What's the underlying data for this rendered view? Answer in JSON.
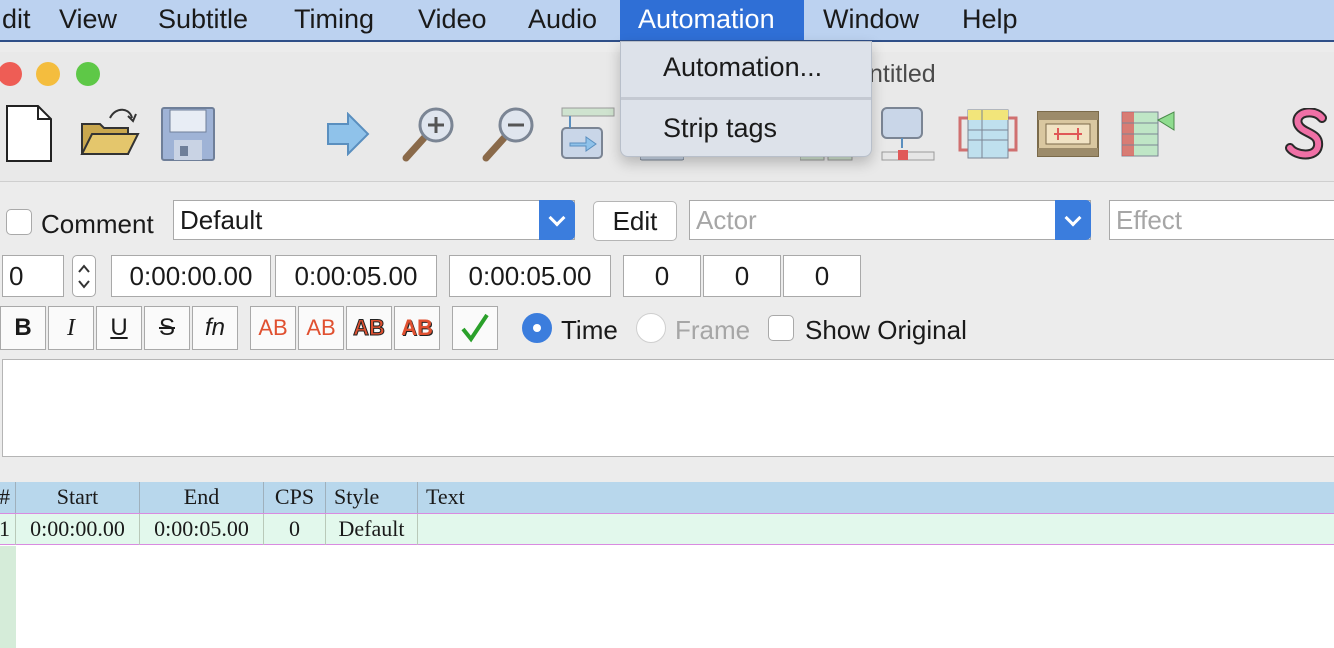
{
  "menubar": {
    "items": [
      "dit",
      "View",
      "Subtitle",
      "Timing",
      "Video",
      "Audio",
      "Automation",
      "Window",
      "Help"
    ],
    "active": "Automation"
  },
  "window": {
    "title": "ntitled"
  },
  "dropdown": {
    "automation": "Automation...",
    "strip_tags": "Strip tags"
  },
  "toolbar": {
    "icons": [
      "new-file-icon",
      "open-folder-icon",
      "save-disk-icon",
      "jump-arrow-icon",
      "zoom-in-icon",
      "zoom-out-icon",
      "snap-icon",
      "video-jump-icon",
      "styles-manager-icon",
      "attachments-icon",
      "karaoke-icon",
      "subtitle-script-icon"
    ]
  },
  "edit": {
    "comment_label": "Comment",
    "style_value": "Default",
    "edit_button": "Edit",
    "actor_placeholder": "Actor",
    "effect_placeholder": "Effect",
    "layer": "0",
    "start": "0:00:00.00",
    "end": "0:00:05.00",
    "duration": "0:00:05.00",
    "margin_l": "0",
    "margin_r": "0",
    "margin_v": "0",
    "bold": "B",
    "italic": "I",
    "underline": "U",
    "strike": "S",
    "fn": "fn",
    "ab1": "AB",
    "ab2": "AB",
    "ab3": "AB",
    "ab4": "AB",
    "time_label": "Time",
    "frame_label": "Frame",
    "show_original_label": "Show Original",
    "time_selected": true
  },
  "grid": {
    "headers": [
      "#",
      "Start",
      "End",
      "CPS",
      "Style",
      "Text"
    ],
    "rows": [
      {
        "num": "1",
        "start": "0:00:00.00",
        "end": "0:00:05.00",
        "cps": "0",
        "style": "Default",
        "text": ""
      }
    ]
  },
  "colors": {
    "menubar_bg": "#bcd2f0",
    "menu_active": "#2f6fd6",
    "accent": "#3b7ddd",
    "grid_header": "#b8d7ec",
    "grid_row": "#e2f8ec"
  }
}
